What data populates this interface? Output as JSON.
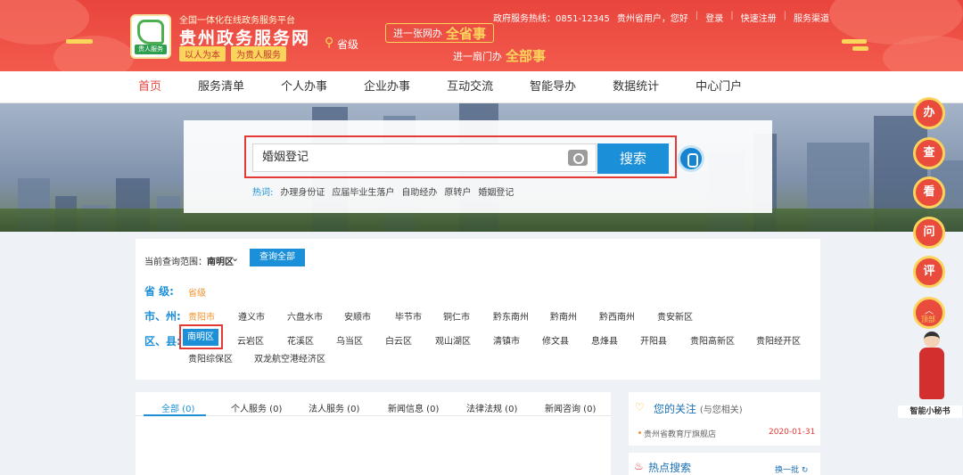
{
  "header": {
    "logo_tag": "贵人服务",
    "site_sub": "全国一体化在线政务服务平台",
    "site_title": "贵州政务服务网",
    "slogan": [
      "以人为本",
      "为贵人服务"
    ],
    "level": "省级",
    "banner1": {
      "small": "进一张网办",
      "big": "全省事"
    },
    "banner2": {
      "small": "进一扇门办",
      "big": "全部事"
    },
    "hotline": "政府服务热线：0851-12345",
    "greeting": "贵州省用户，您好",
    "links": [
      "登录",
      "快速注册",
      "服务渠道"
    ]
  },
  "nav": [
    "首页",
    "服务清单",
    "个人办事",
    "企业办事",
    "互动交流",
    "智能导办",
    "数据统计",
    "中心门户"
  ],
  "search": {
    "value": "婚姻登记",
    "button": "搜索",
    "hot_label": "热词:",
    "hot_items": [
      "办理身份证",
      "应届毕业生落户",
      "自助经办",
      "原转户",
      "婚姻登记"
    ]
  },
  "scope": {
    "label": "当前查询范围：",
    "current": "南明区",
    "query_all": "查询全部",
    "province_label": "省 级:",
    "province_value": "省级",
    "city_label": "市、州:",
    "cities": [
      "贵阳市",
      "遵义市",
      "六盘水市",
      "安顺市",
      "毕节市",
      "铜仁市",
      "黔东南州",
      "黔南州",
      "黔西南州",
      "贵安新区"
    ],
    "county_label": "区、县:",
    "selected_county": "南明区",
    "counties": [
      "云岩区",
      "花溪区",
      "乌当区",
      "白云区",
      "观山湖区",
      "清镇市",
      "修文县",
      "息烽县",
      "开阳县",
      "贵阳高新区",
      "贵阳经开区"
    ],
    "counties_row2": [
      "贵阳综保区",
      "双龙航空港经济区"
    ]
  },
  "results": {
    "tabs": [
      "全部 (0)",
      "个人服务 (0)",
      "法人服务 (0)",
      "新闻信息 (0)",
      "法律法规 (0)",
      "新闻咨询 (0)"
    ]
  },
  "attention": {
    "title": "您的关注",
    "subtitle": "(与您相关)",
    "item": "贵州省教育厅旗舰店",
    "date": "2020-01-31"
  },
  "hotsearch": {
    "title": "热点搜索",
    "more": "换一批"
  },
  "float": {
    "buttons": [
      "办",
      "查",
      "看",
      "问",
      "评"
    ],
    "top": "顶部",
    "assistant": "智能小秘书"
  },
  "colors": {
    "header_red": "#e9453d",
    "accent_blue": "#1b8fd8",
    "gold": "#fbd45b"
  }
}
